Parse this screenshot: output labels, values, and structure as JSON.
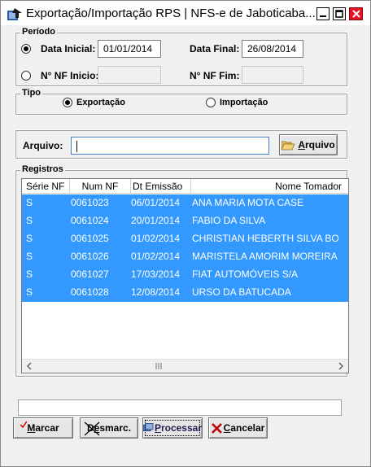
{
  "window": {
    "title": "Exportação/Importação RPS  |  NFS-e de Jaboticaba...",
    "controls": {
      "minimize": "minimize-icon",
      "maximize": "maximize-icon",
      "close": "close-icon"
    }
  },
  "periodo": {
    "legend": "Período",
    "data_inicial_label": "Data Inicial:",
    "data_inicial_value": "01/01/2014",
    "data_final_label": "Data Final:",
    "data_final_value": "26/08/2014",
    "nf_inicio_label": "N° NF Inicio:",
    "nf_inicio_value": "",
    "nf_fim_label": "N° NF Fim:",
    "nf_fim_value": ""
  },
  "tipo": {
    "legend": "Tipo",
    "exportacao_label": "Exportação",
    "importacao_label": "Importação",
    "selected": "Exportação"
  },
  "arquivo": {
    "label": "Arquivo:",
    "value": "",
    "button_prefix": "",
    "button_underlined": "A",
    "button_rest": "rquivo"
  },
  "registros": {
    "legend": "Registros",
    "columns": [
      "Série NF",
      "Num NF",
      "Dt Emissão",
      "Nome Tomador"
    ],
    "rows": [
      [
        "S",
        "0061023",
        "06/01/2014",
        "ANA MARIA MOTA CASE"
      ],
      [
        "S",
        "0061024",
        "20/01/2014",
        "FABIO DA SILVA"
      ],
      [
        "S",
        "0061025",
        "01/02/2014",
        "CHRISTIAN HEBERTH SILVA  BO"
      ],
      [
        "S",
        "0061026",
        "01/02/2014",
        "MARISTELA AMORIM MOREIRA"
      ],
      [
        "S",
        "0061027",
        "17/03/2014",
        "FIAT AUTOMÓVEIS S/A"
      ],
      [
        "S",
        "0061028",
        "12/08/2014",
        "URSO DA BATUCADA"
      ]
    ],
    "selection_color": "#3399ff"
  },
  "status_text": "",
  "buttons": {
    "marcar_u": "M",
    "marcar_rest": "arcar",
    "desmarc_pre": "D",
    "desmarc_u": "e",
    "desmarc_rest": "smarc.",
    "processar_u": "P",
    "processar_rest": "rocessar",
    "cancelar_u": "C",
    "cancelar_rest": "ancelar"
  }
}
